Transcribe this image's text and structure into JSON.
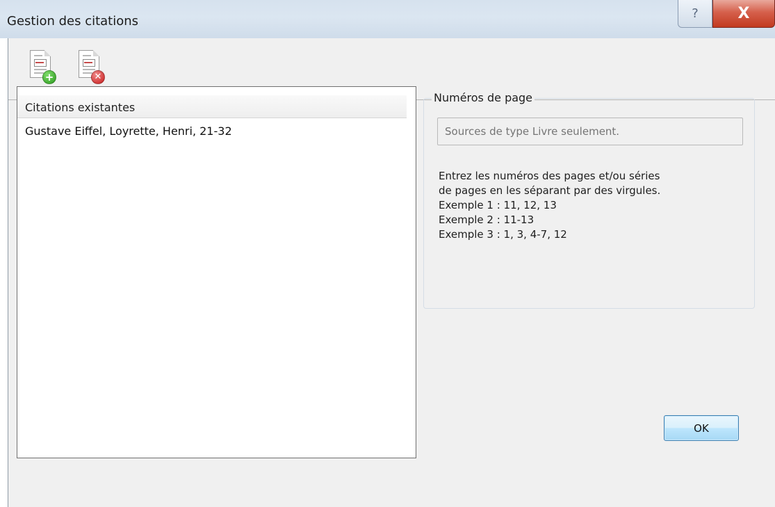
{
  "window": {
    "title": "Gestion des citations",
    "help_glyph": "?",
    "close_glyph": "X"
  },
  "toolbar": {
    "add_icon": "add-citation-icon",
    "delete_icon": "delete-citation-icon"
  },
  "citations": {
    "header": "Citations existantes",
    "items": [
      "Gustave Eiffel, Loyrette, Henri, 21-32"
    ]
  },
  "page_numbers": {
    "legend": "Numéros de page",
    "placeholder": "Sources de type Livre seulement.",
    "instructions": "Entrez les numéros des pages et/ou séries\nde pages en les séparant par des virgules.\nExemple 1 : 11, 12, 13\nExemple 2 : 11-13\nExemple 3 : 1, 3, 4-7, 12"
  },
  "buttons": {
    "ok_label": "OK"
  },
  "colors": {
    "accent": "#3c7fb1",
    "close_red": "#c2391f",
    "add_green": "#2b9b1e",
    "delete_red": "#c81a1a"
  }
}
